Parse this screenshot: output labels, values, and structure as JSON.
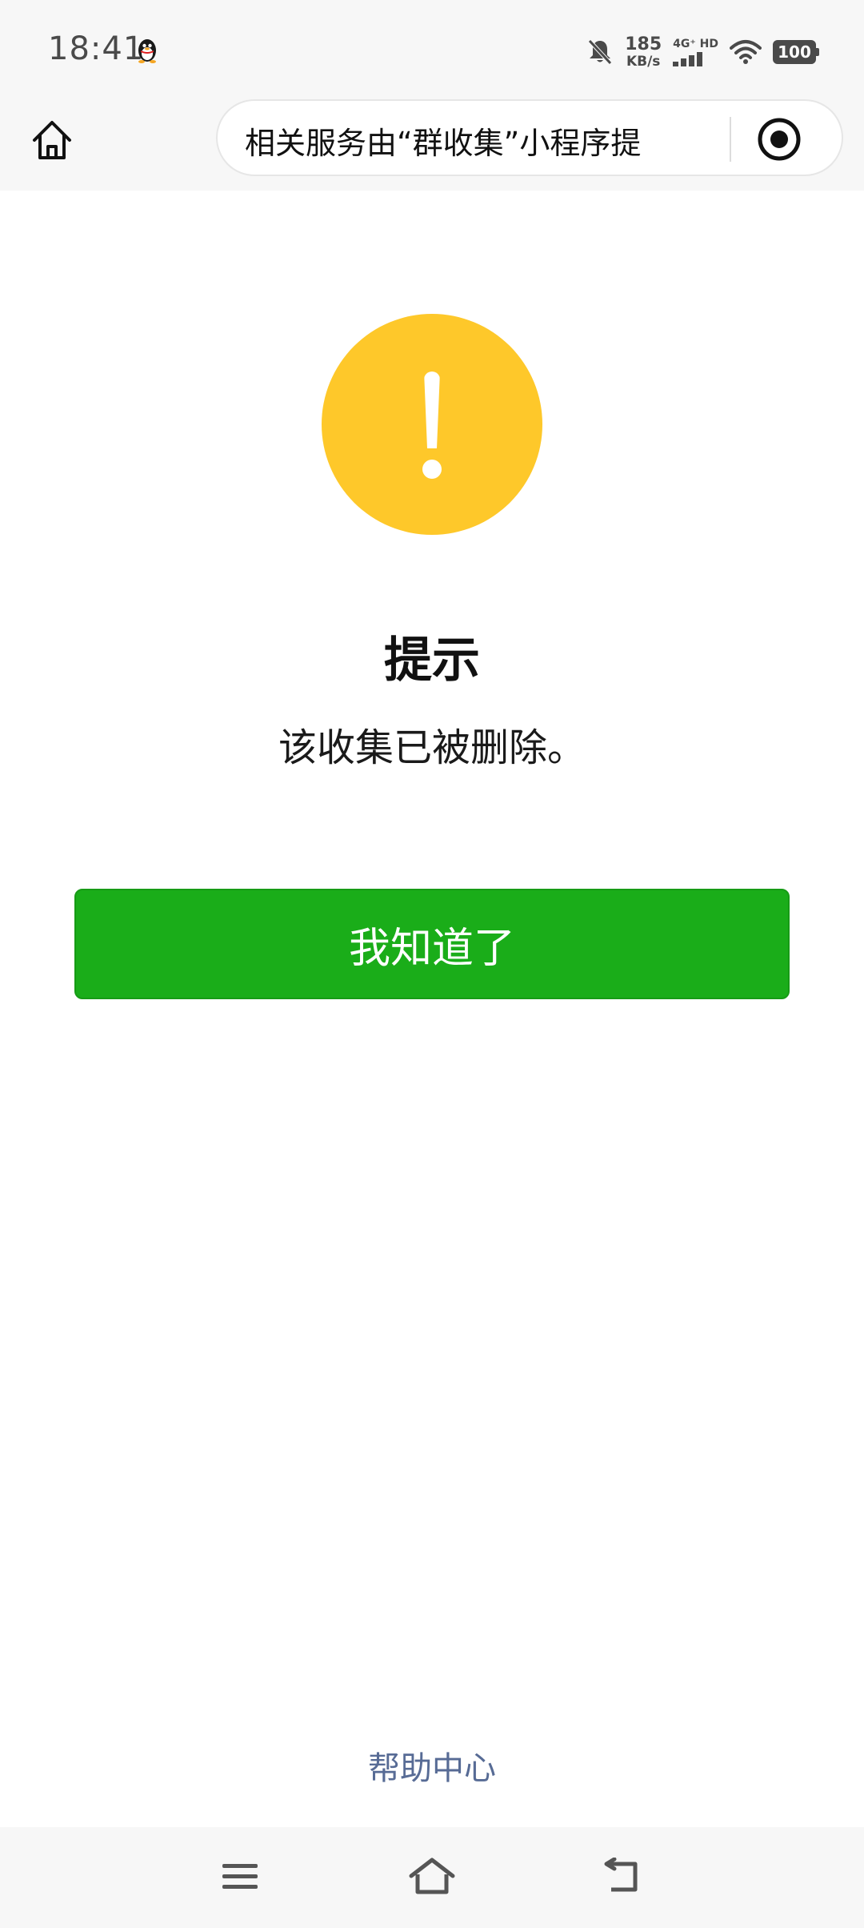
{
  "status_bar": {
    "time": "18:41",
    "net_speed_value": "185",
    "net_speed_unit": "KB/s",
    "signal_label": "4G⁺ HD",
    "battery": "100",
    "icons": [
      "qq-penguin-icon",
      "mute-bell-icon",
      "signal-icon",
      "wifi-icon",
      "battery-icon"
    ]
  },
  "nav_bar": {
    "home_icon": "home-icon",
    "capsule_text": "相关服务由“群收集”小程序提",
    "target_icon": "target-icon"
  },
  "content": {
    "icon": "warning-icon",
    "title": "提示",
    "message": "该收集已被删除。",
    "confirm_label": "我知道了"
  },
  "footer": {
    "help_label": "帮助中心"
  },
  "system_nav": {
    "icons": [
      "menu-icon",
      "home-icon",
      "back-icon"
    ]
  },
  "colors": {
    "warning": "#fec82a",
    "primary_button": "#1aad19",
    "link": "#576b95",
    "bar_background": "#f7f7f7"
  }
}
